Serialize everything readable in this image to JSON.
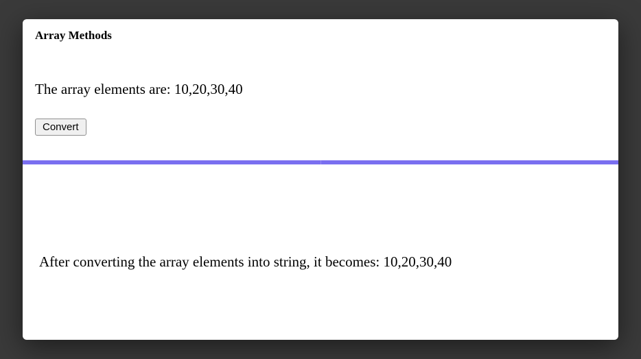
{
  "title": "Array Methods",
  "array_line": "The array elements are: 10,20,30,40",
  "button_label": "Convert",
  "result_line": "After converting the array elements into string, it becomes: 10,20,30,40"
}
